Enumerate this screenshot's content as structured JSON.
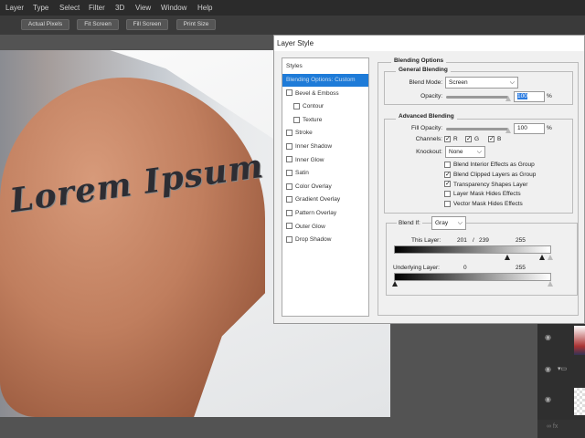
{
  "menubar": {
    "items": [
      "Layer",
      "Type",
      "Select",
      "Filter",
      "3D",
      "View",
      "Window",
      "Help"
    ]
  },
  "optionsbar": {
    "buttons": [
      "Actual Pixels",
      "Fit Screen",
      "Fill Screen",
      "Print Size"
    ]
  },
  "canvas": {
    "tattoo_text": "Lorem Ipsum"
  },
  "dialog": {
    "title": "Layer Style",
    "styles_header": "Styles",
    "styles": [
      {
        "label": "Blending Options: Custom",
        "selected": true
      },
      {
        "label": "Bevel & Emboss",
        "checked": false
      },
      {
        "label": "Contour",
        "checked": false
      },
      {
        "label": "Texture",
        "checked": false
      },
      {
        "label": "Stroke",
        "checked": false
      },
      {
        "label": "Inner Shadow",
        "checked": false
      },
      {
        "label": "Inner Glow",
        "checked": false
      },
      {
        "label": "Satin",
        "checked": false
      },
      {
        "label": "Color Overlay",
        "checked": false
      },
      {
        "label": "Gradient Overlay",
        "checked": false
      },
      {
        "label": "Pattern Overlay",
        "checked": false
      },
      {
        "label": "Outer Glow",
        "checked": false
      },
      {
        "label": "Drop Shadow",
        "checked": false
      }
    ],
    "blending_options": "Blending Options",
    "general": {
      "title": "General Blending",
      "blend_mode_label": "Blend Mode:",
      "blend_mode": "Screen",
      "opacity_label": "Opacity:",
      "opacity": "100",
      "pct": "%"
    },
    "advanced": {
      "title": "Advanced Blending",
      "fill_opacity_label": "Fill Opacity:",
      "fill_opacity": "100",
      "pct": "%",
      "channels_label": "Channels:",
      "channels": [
        "R",
        "G",
        "B"
      ],
      "knockout_label": "Knockout:",
      "knockout": "None",
      "options": [
        {
          "label": "Blend Interior Effects as Group",
          "checked": false
        },
        {
          "label": "Blend Clipped Layers as Group",
          "checked": true
        },
        {
          "label": "Transparency Shapes Layer",
          "checked": true
        },
        {
          "label": "Layer Mask Hides Effects",
          "checked": false
        },
        {
          "label": "Vector Mask Hides Effects",
          "checked": false
        }
      ]
    },
    "blend_if": {
      "label": "Blend If:",
      "value": "Gray",
      "this_layer_label": "This Layer:",
      "this_layer_low": "201",
      "slash": "/",
      "this_layer_mid": "239",
      "this_layer_high": "255",
      "underlying_label": "Underlying Layer:",
      "underlying_low": "0",
      "underlying_high": "255"
    }
  },
  "check_mark": "✓",
  "eye_icon": "◉",
  "chevron": "⌵"
}
